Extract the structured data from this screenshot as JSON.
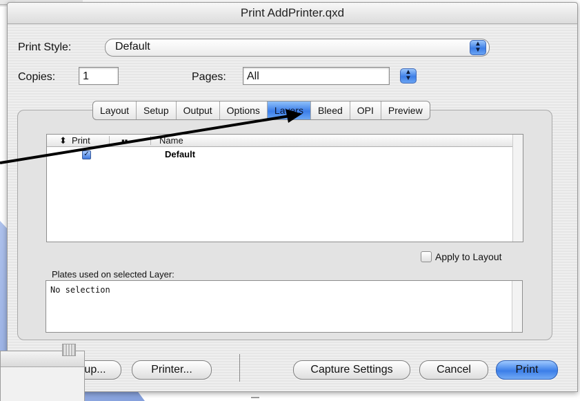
{
  "dialog": {
    "title": "Print AddPrinter.qxd"
  },
  "print_style": {
    "label": "Print Style:",
    "value": "Default"
  },
  "copies": {
    "label": "Copies:",
    "value": "1"
  },
  "pages": {
    "label": "Pages:",
    "value": "All"
  },
  "tabs": [
    {
      "label": "Layout"
    },
    {
      "label": "Setup"
    },
    {
      "label": "Output"
    },
    {
      "label": "Options"
    },
    {
      "label": "Layers"
    },
    {
      "label": "Bleed"
    },
    {
      "label": "OPI"
    },
    {
      "label": "Preview"
    }
  ],
  "active_tab": "Layers",
  "layers_table": {
    "columns": {
      "print": "Print",
      "name": "Name"
    },
    "rows": [
      {
        "print_checked": true,
        "name": "Default"
      }
    ]
  },
  "apply_to_layout": {
    "label": "Apply to Layout",
    "checked": false
  },
  "plates": {
    "label": "Plates used on selected Layer:",
    "value": "No selection"
  },
  "buttons": {
    "page_setup": "up...",
    "printer": "Printer...",
    "capture_settings": "Capture Settings",
    "cancel": "Cancel",
    "print": "Print"
  },
  "colors": {
    "accent_blue": "#3b7de8",
    "annotation_arrow": "#000000"
  }
}
